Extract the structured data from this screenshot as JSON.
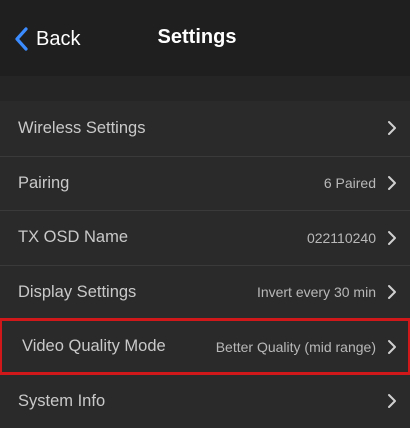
{
  "navbar": {
    "back_label": "Back",
    "title": "Settings",
    "accent_color": "#3b8cff"
  },
  "rows": [
    {
      "label": "Wireless Settings",
      "value": ""
    },
    {
      "label": "Pairing",
      "value": "6 Paired"
    },
    {
      "label": "TX OSD Name",
      "value": "022110240"
    },
    {
      "label": "Display Settings",
      "value": "Invert every 30 min"
    },
    {
      "label": "Video Quality Mode",
      "value": "Better Quality (mid range)"
    },
    {
      "label": "System Info",
      "value": ""
    }
  ],
  "highlight_color": "#d0181b"
}
